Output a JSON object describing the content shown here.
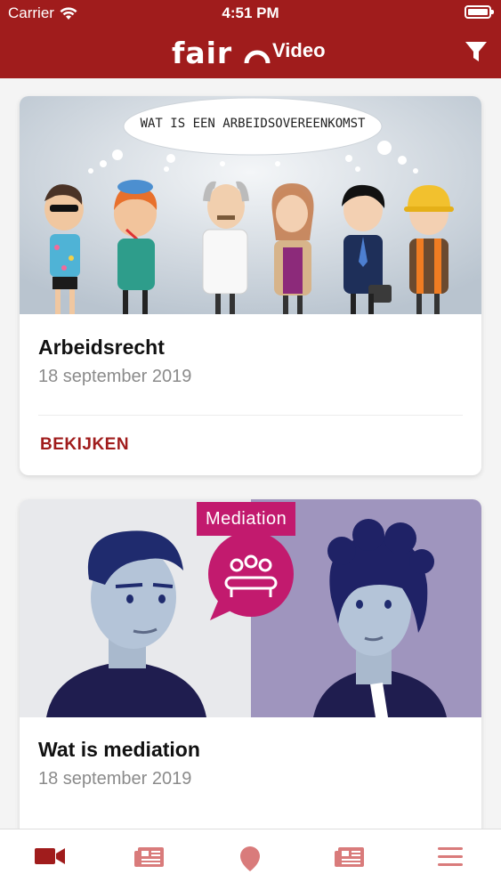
{
  "status_bar": {
    "carrier": "Carrier",
    "time": "4:51 PM"
  },
  "header": {
    "logo_text": "fair",
    "title": "Video"
  },
  "videos": [
    {
      "title": "Arbeidsrecht",
      "date": "18 september 2019",
      "action_label": "BEKIJKEN",
      "thought_bubble": "WAT IS EEN ARBEIDSOVEREENKOMST"
    },
    {
      "title": "Wat is mediation",
      "date": "18 september 2019",
      "tag": "Mediation"
    }
  ],
  "tabs": [
    {
      "icon": "video-camera-icon",
      "active": true
    },
    {
      "icon": "newspaper-icon",
      "active": false
    },
    {
      "icon": "map-pin-icon",
      "active": false
    },
    {
      "icon": "newspaper-icon",
      "active": false
    },
    {
      "icon": "hamburger-menu-icon",
      "active": false
    }
  ],
  "colors": {
    "brand": "#a01c1c",
    "tab_inactive": "#d97b7b",
    "mediation_accent": "#c21a6e",
    "date_gray": "#8b8b8b"
  }
}
